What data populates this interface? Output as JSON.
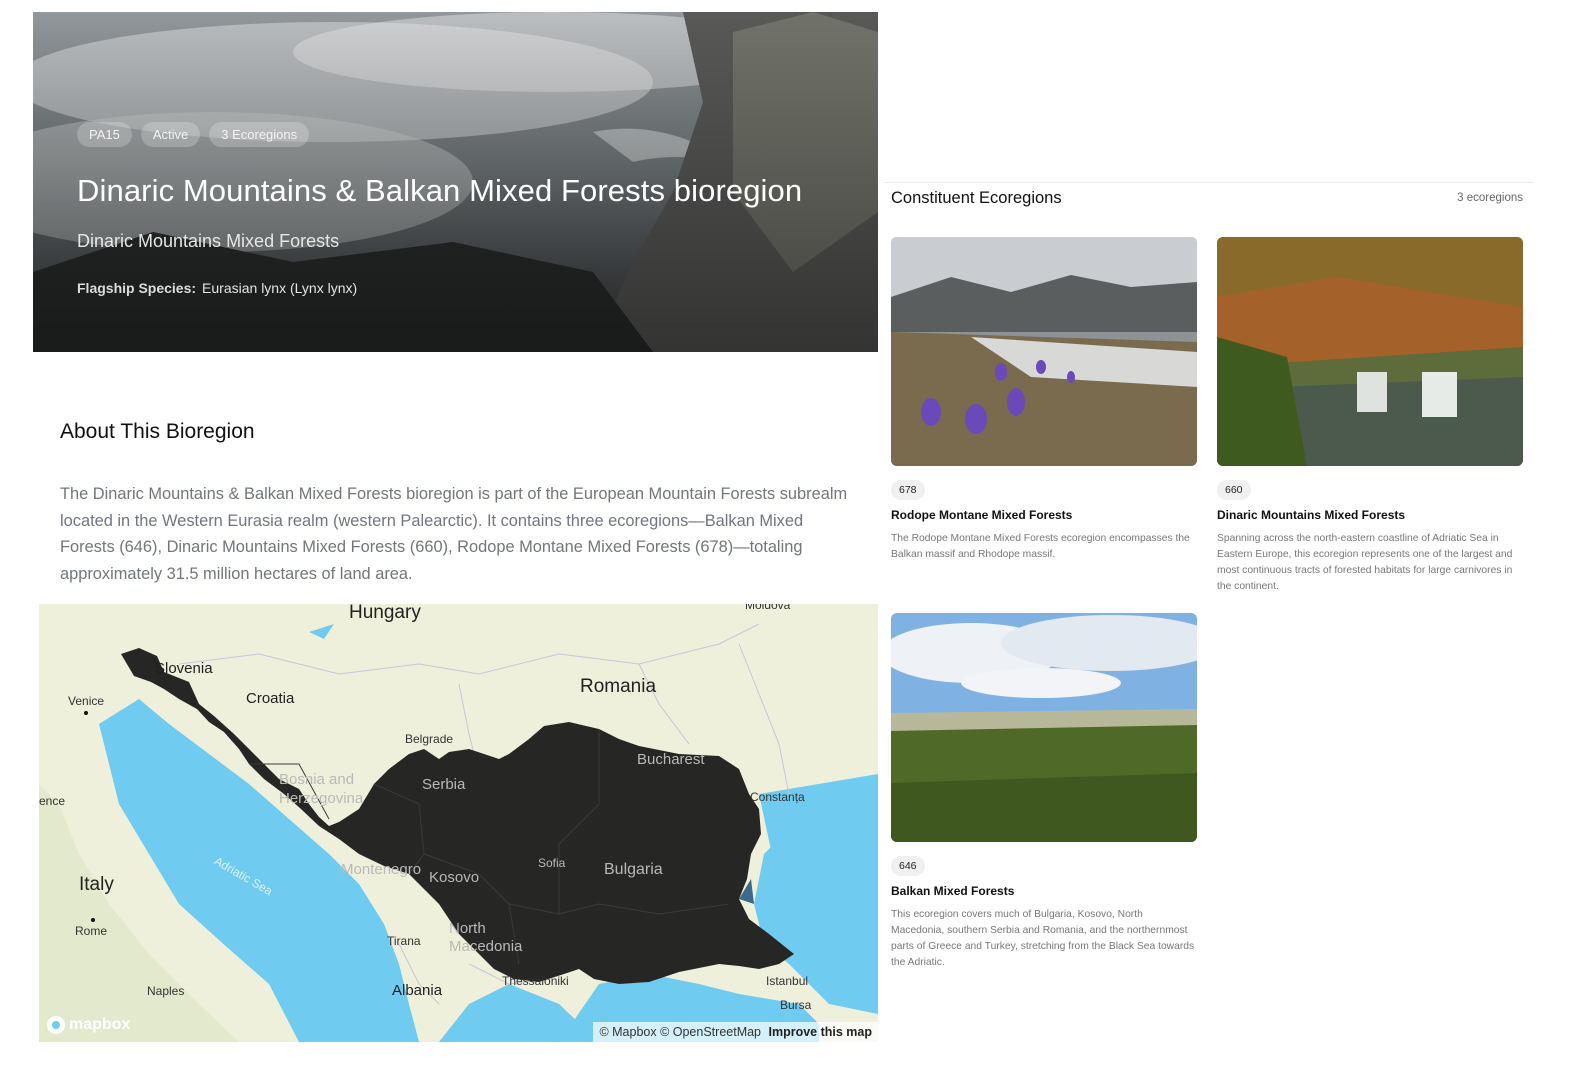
{
  "hero": {
    "badges": [
      "PA15",
      "Active",
      "3 Ecoregions"
    ],
    "title": "Dinaric Mountains & Balkan Mixed Forests bioregion",
    "subtitle": "Dinaric Mountains Mixed Forests",
    "flagship_label": "Flagship Species:",
    "flagship_value": "Eurasian lynx (Lynx lynx)"
  },
  "about": {
    "title": "About This Bioregion",
    "text": "The Dinaric Mountains & Balkan Mixed Forests bioregion is part of the European Mountain Forests subrealm located in the Western Eurasia realm (western Palearctic). It contains three ecoregions—Balkan Mixed Forests (646), Dinaric Mountains Mixed Forests (660), Rodope Montane Mixed Forests (678)—totaling approximately 31.5 million hectares of land area."
  },
  "map": {
    "labels": {
      "hungary": "Hungary",
      "moldova": "Moldova",
      "slovenia": "Slovenia",
      "croatia": "Croatia",
      "romania": "Romania",
      "venice": "Venice",
      "belgrade": "Belgrade",
      "bucharest": "Bucharest",
      "bosnia": "Bosnia and Herzegovina",
      "serbia": "Serbia",
      "florence": "ence",
      "constanta": "Constanța",
      "montenegro": "Montenegro",
      "kosovo": "Kosovo",
      "sofia": "Sofia",
      "bulgaria": "Bulgaria",
      "italy": "Italy",
      "adriatic": "Adriatic Sea",
      "rome": "Rome",
      "tirana": "Tirana",
      "north_macedonia": "North Macedonia",
      "naples": "Naples",
      "albania": "Albania",
      "thessaloniki": "Thessaloniki",
      "istanbul": "Istanbul",
      "bursa": "Bursa"
    },
    "logo": "mapbox",
    "attribution": "© Mapbox © OpenStreetMap",
    "improve": "Improve this map",
    "colors": {
      "water": "#6fcbef",
      "land": "#eef0dc",
      "region": "#262624"
    }
  },
  "ecoregions": {
    "title": "Constituent Ecoregions",
    "count": "3 ecoregions",
    "items": [
      {
        "id": "678",
        "name": "Rodope Montane Mixed Forests",
        "desc": "The Rodope Montane Mixed Forests ecoregion encompasses the Balkan massif and Rhodope massif."
      },
      {
        "id": "660",
        "name": "Dinaric Mountains Mixed Forests",
        "desc": "Spanning across the north-eastern coastline of Adriatic Sea in Eastern Europe, this ecoregion represents one of the largest and most continuous tracts of forested habitats for large carnivores in the continent."
      },
      {
        "id": "646",
        "name": "Balkan Mixed Forests",
        "desc": "This ecoregion covers much of Bulgaria, Kosovo, North Macedonia, southern Serbia and Romania, and the northernmost parts of Greece and Turkey, stretching from the Black Sea towards the Adriatic."
      }
    ]
  }
}
